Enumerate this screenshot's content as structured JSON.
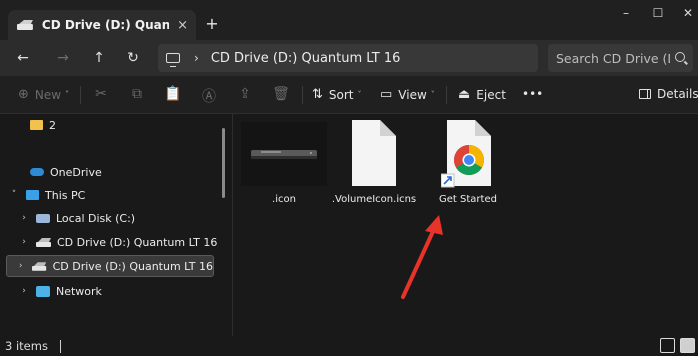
{
  "window": {
    "tab_title": "CD Drive (D:) Quantum LT",
    "tab_close": "×",
    "new_tab": "+",
    "minimize": "–",
    "maximize": "☐",
    "close": "✕"
  },
  "navigation": {
    "back": "←",
    "forward": "→",
    "up": "↑",
    "refresh": "↻",
    "address_separator": "›",
    "address": "CD Drive (D:) Quantum LT 16",
    "search_placeholder": "Search CD Drive (D:)"
  },
  "command_bar": {
    "new_label": "New",
    "sort_label": "Sort",
    "view_label": "View",
    "eject_label": "Eject",
    "more_label": "•••",
    "details_label": "Details"
  },
  "sidebar": {
    "items": [
      {
        "label": "2",
        "icon": "folder-icon"
      },
      {
        "label": "OneDrive",
        "icon": "onedrive-icon"
      },
      {
        "label": "This PC",
        "icon": "this-pc-icon",
        "expanded": true
      },
      {
        "label": "Local Disk (C:)",
        "icon": "local-disk-icon"
      },
      {
        "label": "CD Drive (D:) Quantum LT 16",
        "icon": "cd-drive-icon"
      },
      {
        "label": "CD Drive (D:) Quantum LT 16",
        "icon": "cd-drive-icon",
        "selected": true
      },
      {
        "label": "Network",
        "icon": "network-icon"
      }
    ]
  },
  "files": [
    {
      "name": ".icon",
      "icon": "drive-thumbnail-icon"
    },
    {
      "name": ".VolumeIcon.icns",
      "icon": "blank-document-icon"
    },
    {
      "name": "Get Started",
      "icon": "chrome-shortcut-icon"
    }
  ],
  "status": {
    "item_count": "3 items"
  },
  "colors": {
    "background": "#191919",
    "titlebar": "#202020",
    "address_bar": "#2c2c2c",
    "annotation_arrow": "#e8332a",
    "selected_item": "#3a3a3a"
  }
}
